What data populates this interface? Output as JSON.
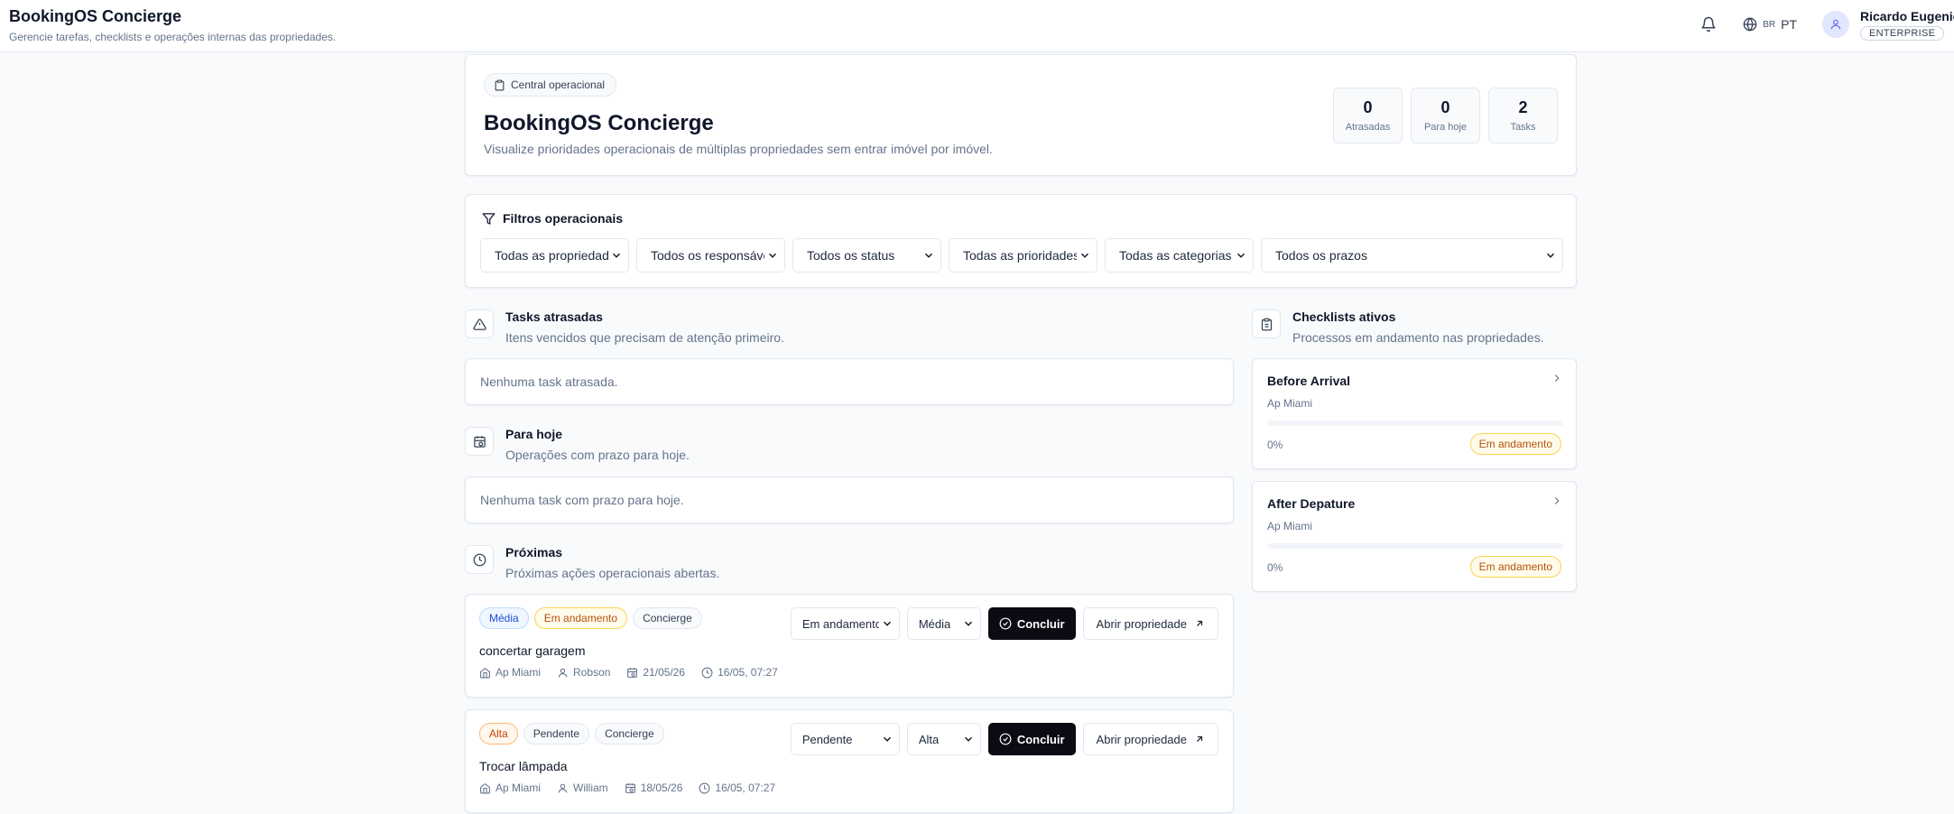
{
  "header": {
    "title": "BookingOS Concierge",
    "subtitle": "Gerencie tarefas, checklists e operações internas das propriedades.",
    "language_flag": "BR",
    "language": "PT",
    "user_name": "Ricardo Eugenio",
    "plan": "ENTERPRISE"
  },
  "hero": {
    "chip": "Central operacional",
    "title": "BookingOS Concierge",
    "description": "Visualize prioridades operacionais de múltiplas propriedades sem entrar imóvel por imóvel.",
    "stats": [
      {
        "value": "0",
        "label": "Atrasadas"
      },
      {
        "value": "0",
        "label": "Para hoje"
      },
      {
        "value": "2",
        "label": "Tasks"
      }
    ]
  },
  "filters": {
    "title": "Filtros operacionais",
    "selects": [
      "Todas as propriedades",
      "Todos os responsáveis",
      "Todos os status",
      "Todas as prioridades",
      "Todas as categorias",
      "Todos os prazos"
    ]
  },
  "sections": {
    "overdue": {
      "title": "Tasks atrasadas",
      "subtitle": "Itens vencidos que precisam de atenção primeiro.",
      "empty": "Nenhuma task atrasada."
    },
    "today": {
      "title": "Para hoje",
      "subtitle": "Operações com prazo para hoje.",
      "empty": "Nenhuma task com prazo para hoje."
    },
    "next": {
      "title": "Próximas",
      "subtitle": "Próximas ações operacionais abertas."
    },
    "checklists": {
      "title": "Checklists ativos",
      "subtitle": "Processos em andamento nas propriedades."
    }
  },
  "tasks": [
    {
      "priority": "Média",
      "status": "Em andamento",
      "category": "Concierge",
      "title": "concertar garagem",
      "property": "Ap Miami",
      "assignee": "Robson",
      "due": "21/05/26",
      "created": "16/05, 07:27",
      "status_select": "Em andamento",
      "priority_select": "Média",
      "complete_label": "Concluir",
      "open_label": "Abrir propriedade"
    },
    {
      "priority": "Alta",
      "status": "Pendente",
      "category": "Concierge",
      "title": "Trocar lâmpada",
      "property": "Ap Miami",
      "assignee": "William",
      "due": "18/05/26",
      "created": "16/05, 07:27",
      "status_select": "Pendente",
      "priority_select": "Alta",
      "complete_label": "Concluir",
      "open_label": "Abrir propriedade"
    }
  ],
  "checklists": [
    {
      "name": "Before Arrival",
      "property": "Ap Miami",
      "progress_label": "0%",
      "progress": 0,
      "status": "Em andamento"
    },
    {
      "name": "After Depature",
      "property": "Ap Miami",
      "progress_label": "0%",
      "progress": 0,
      "status": "Em andamento"
    }
  ],
  "colors": {
    "primary_button": "#0b0b14",
    "status_progress": "#b45309",
    "priority_medium": "#1d4ed8",
    "priority_high": "#c2410c"
  }
}
